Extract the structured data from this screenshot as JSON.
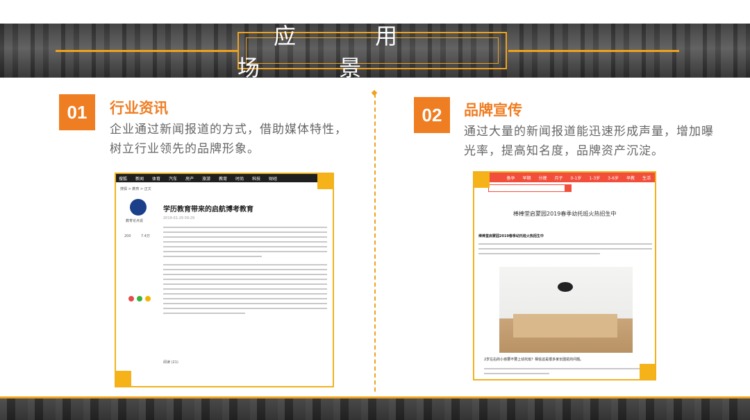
{
  "header": {
    "title": "应 用 场 景"
  },
  "sections": [
    {
      "number": "01",
      "title": "行业资讯",
      "description": "企业通过新闻报道的方式，借助媒体特性，树立行业领先的品牌形象。",
      "screenshot": {
        "nav": [
          "搜狐",
          "新闻",
          "体育",
          "汽车",
          "房产",
          "旅游",
          "教育",
          "时尚",
          "科技",
          "财经"
        ],
        "breadcrumb": "搜狐 > 教育 > 正文",
        "article_title": "学历教育带来的启航博考教育",
        "date": "2019-01-29 09:29",
        "author": "教育论点说",
        "stats": [
          "200",
          "7.4万"
        ],
        "footer": "阅读 (21)"
      }
    },
    {
      "number": "02",
      "title": "品牌宣传",
      "description": "通过大量的新闻报道能迅速形成声量，增加曝光率，提高知名度，品牌资产沉淀。",
      "screenshot": {
        "nav": [
          "备孕",
          "早期",
          "分娩",
          "月子",
          "0-1岁",
          "1-3岁",
          "3-6岁",
          "早教",
          "生活"
        ],
        "article_title": "棒棒堂启蒙园2019春季幼托班火热招生中",
        "subtitle": "棒棒堂启蒙园2019春季幼托班火热招生中",
        "caption": "2岁左右的小孩要不要上幼托班？相信这是很多家长困扰的问题。"
      }
    }
  ]
}
